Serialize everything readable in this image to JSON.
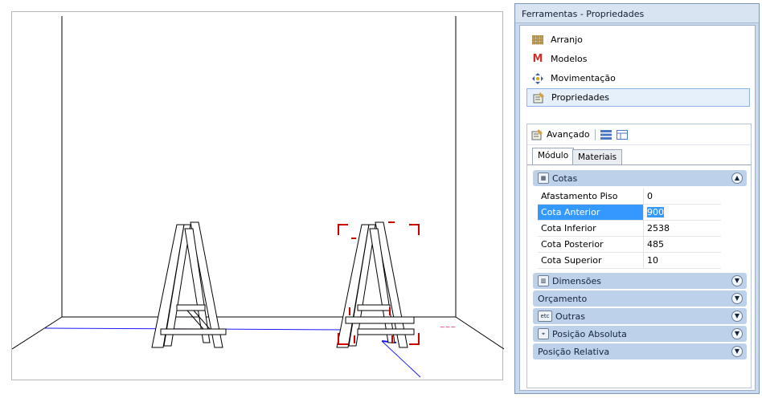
{
  "panel": {
    "title": "Ferramentas - Propriedades",
    "nav": [
      {
        "label": "Arranjo",
        "icon": "grid-icon"
      },
      {
        "label": "Modelos",
        "icon": "models-icon"
      },
      {
        "label": "Movimentação",
        "icon": "move-icon"
      },
      {
        "label": "Propriedades",
        "icon": "properties-icon"
      }
    ],
    "advanced_label": "Avançado",
    "tabs": [
      "Módulo",
      "Materiais"
    ],
    "cotas": {
      "title": "Cotas",
      "rows": [
        {
          "key": "Afastamento Piso",
          "value": "0"
        },
        {
          "key": "Cota Anterior",
          "value": "900"
        },
        {
          "key": "Cota Inferior",
          "value": "2538"
        },
        {
          "key": "Cota Posterior",
          "value": "485"
        },
        {
          "key": "Cota Superior",
          "value": "10"
        }
      ]
    },
    "groups": [
      "Dimensões",
      "Orçamento",
      "Outras",
      "Posição Absoluta",
      "Posição Relativa"
    ],
    "etc_label": "etc"
  },
  "colors": {
    "selection": "#3399ff",
    "group_header": "#bdd1ea",
    "frame": "#c9daf0",
    "marker": "#cc0000",
    "axis": "#1a1aff"
  }
}
